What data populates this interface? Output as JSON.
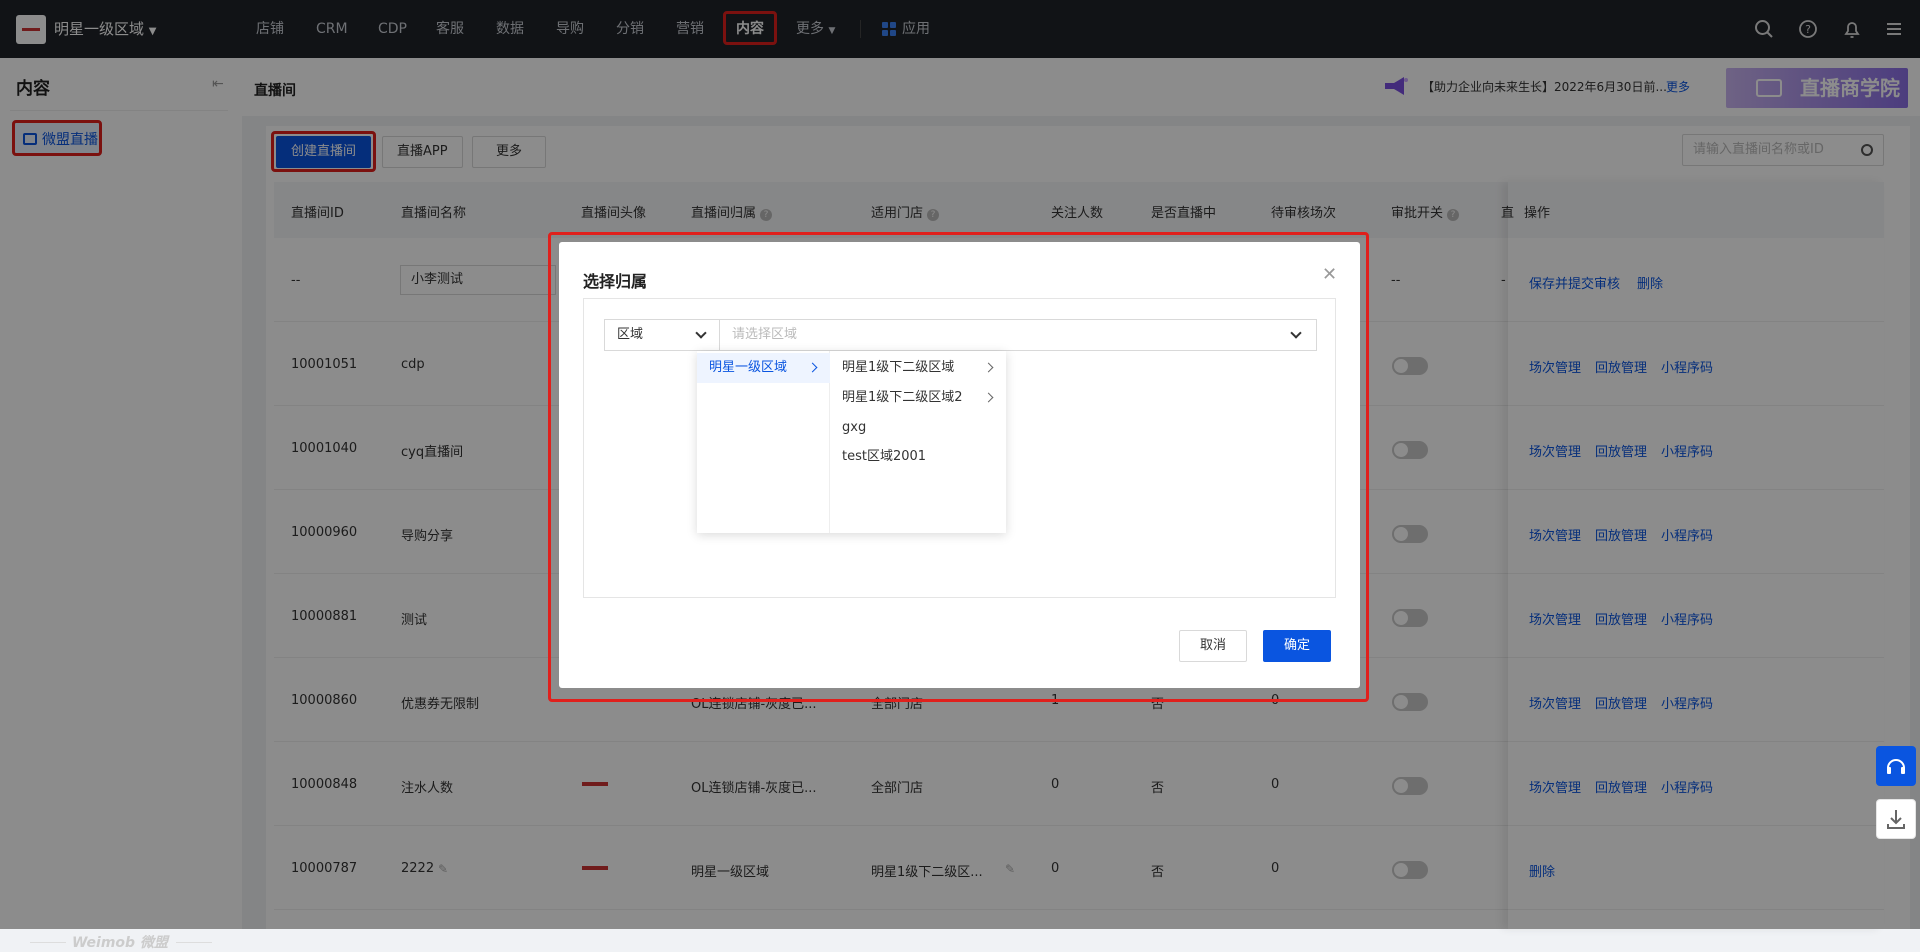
{
  "topbar": {
    "org": "明星一级区域",
    "nav": [
      "店铺",
      "CRM",
      "CDP",
      "客服",
      "数据",
      "导购",
      "分销",
      "营销",
      "内容",
      "更多"
    ],
    "active_nav": "内容",
    "apps_label": "应用"
  },
  "sidebar": {
    "title": "内容",
    "items": [
      {
        "label": "微盟直播"
      }
    ],
    "watermark": "Weimob 微盟"
  },
  "header": {
    "title": "直播间",
    "notice": "【助力企业向未来生长】2022年6月30日前...",
    "notice_more": "更多",
    "banner": "直播商学院"
  },
  "toolbar": {
    "create": "创建直播间",
    "app": "直播APP",
    "more": "更多",
    "search_placeholder": "请输入直播间名称或ID"
  },
  "table": {
    "columns": [
      "直播间ID",
      "直播间名称",
      "直播间头像",
      "直播间归属",
      "适用门店",
      "关注人数",
      "是否直播中",
      "待审核场次",
      "审批开关",
      "直",
      "操作"
    ],
    "rows": [
      {
        "id": "--",
        "name": "小李测试",
        "owner": "",
        "stores": "",
        "followers": "",
        "live": "",
        "pending": "",
        "approval": "--",
        "extra": "-",
        "actions": [
          "保存并提交审核",
          "删除"
        ]
      },
      {
        "id": "10001051",
        "name": "cdp",
        "owner": "",
        "stores": "",
        "followers": "",
        "live": "",
        "pending": "",
        "actions": [
          "场次管理",
          "回放管理",
          "小程序码"
        ]
      },
      {
        "id": "10001040",
        "name": "cyq直播间",
        "owner": "",
        "stores": "",
        "followers": "",
        "live": "",
        "pending": "",
        "actions": [
          "场次管理",
          "回放管理",
          "小程序码"
        ]
      },
      {
        "id": "10000960",
        "name": "导购分享",
        "owner": "",
        "stores": "",
        "followers": "",
        "live": "",
        "pending": "",
        "actions": [
          "场次管理",
          "回放管理",
          "小程序码"
        ]
      },
      {
        "id": "10000881",
        "name": "测试",
        "owner": "",
        "stores": "",
        "followers": "",
        "live": "",
        "pending": "",
        "actions": [
          "场次管理",
          "回放管理",
          "小程序码"
        ]
      },
      {
        "id": "10000860",
        "name": "优惠券无限制",
        "owner": "OL连锁店铺-灰度已...",
        "stores": "全部门店",
        "followers": "1",
        "live": "否",
        "pending": "0",
        "actions": [
          "场次管理",
          "回放管理",
          "小程序码"
        ]
      },
      {
        "id": "10000848",
        "name": "注水人数",
        "owner": "OL连锁店铺-灰度已...",
        "stores": "全部门店",
        "followers": "0",
        "live": "否",
        "pending": "0",
        "actions": [
          "场次管理",
          "回放管理",
          "小程序码"
        ]
      },
      {
        "id": "10000787",
        "name": "2222",
        "owner": "明星一级区域",
        "stores": "明星1级下二级区...",
        "followers": "0",
        "live": "否",
        "pending": "0",
        "actions": [
          "删除"
        ]
      }
    ]
  },
  "modal": {
    "title": "选择归属",
    "type_value": "区域",
    "area_placeholder": "请选择区域",
    "level1": [
      {
        "label": "明星一级区域",
        "selected": true
      }
    ],
    "level2": [
      {
        "label": "明星1级下二级区域",
        "has_children": true
      },
      {
        "label": "明星1级下二级区域2",
        "has_children": true
      },
      {
        "label": "gxg",
        "has_children": false
      },
      {
        "label": "test区域2001",
        "has_children": false
      }
    ],
    "cancel": "取消",
    "confirm": "确定"
  },
  "colors": {
    "primary": "#0a55e0",
    "highlight": "#e0201c",
    "topbar": "#1f2329"
  }
}
